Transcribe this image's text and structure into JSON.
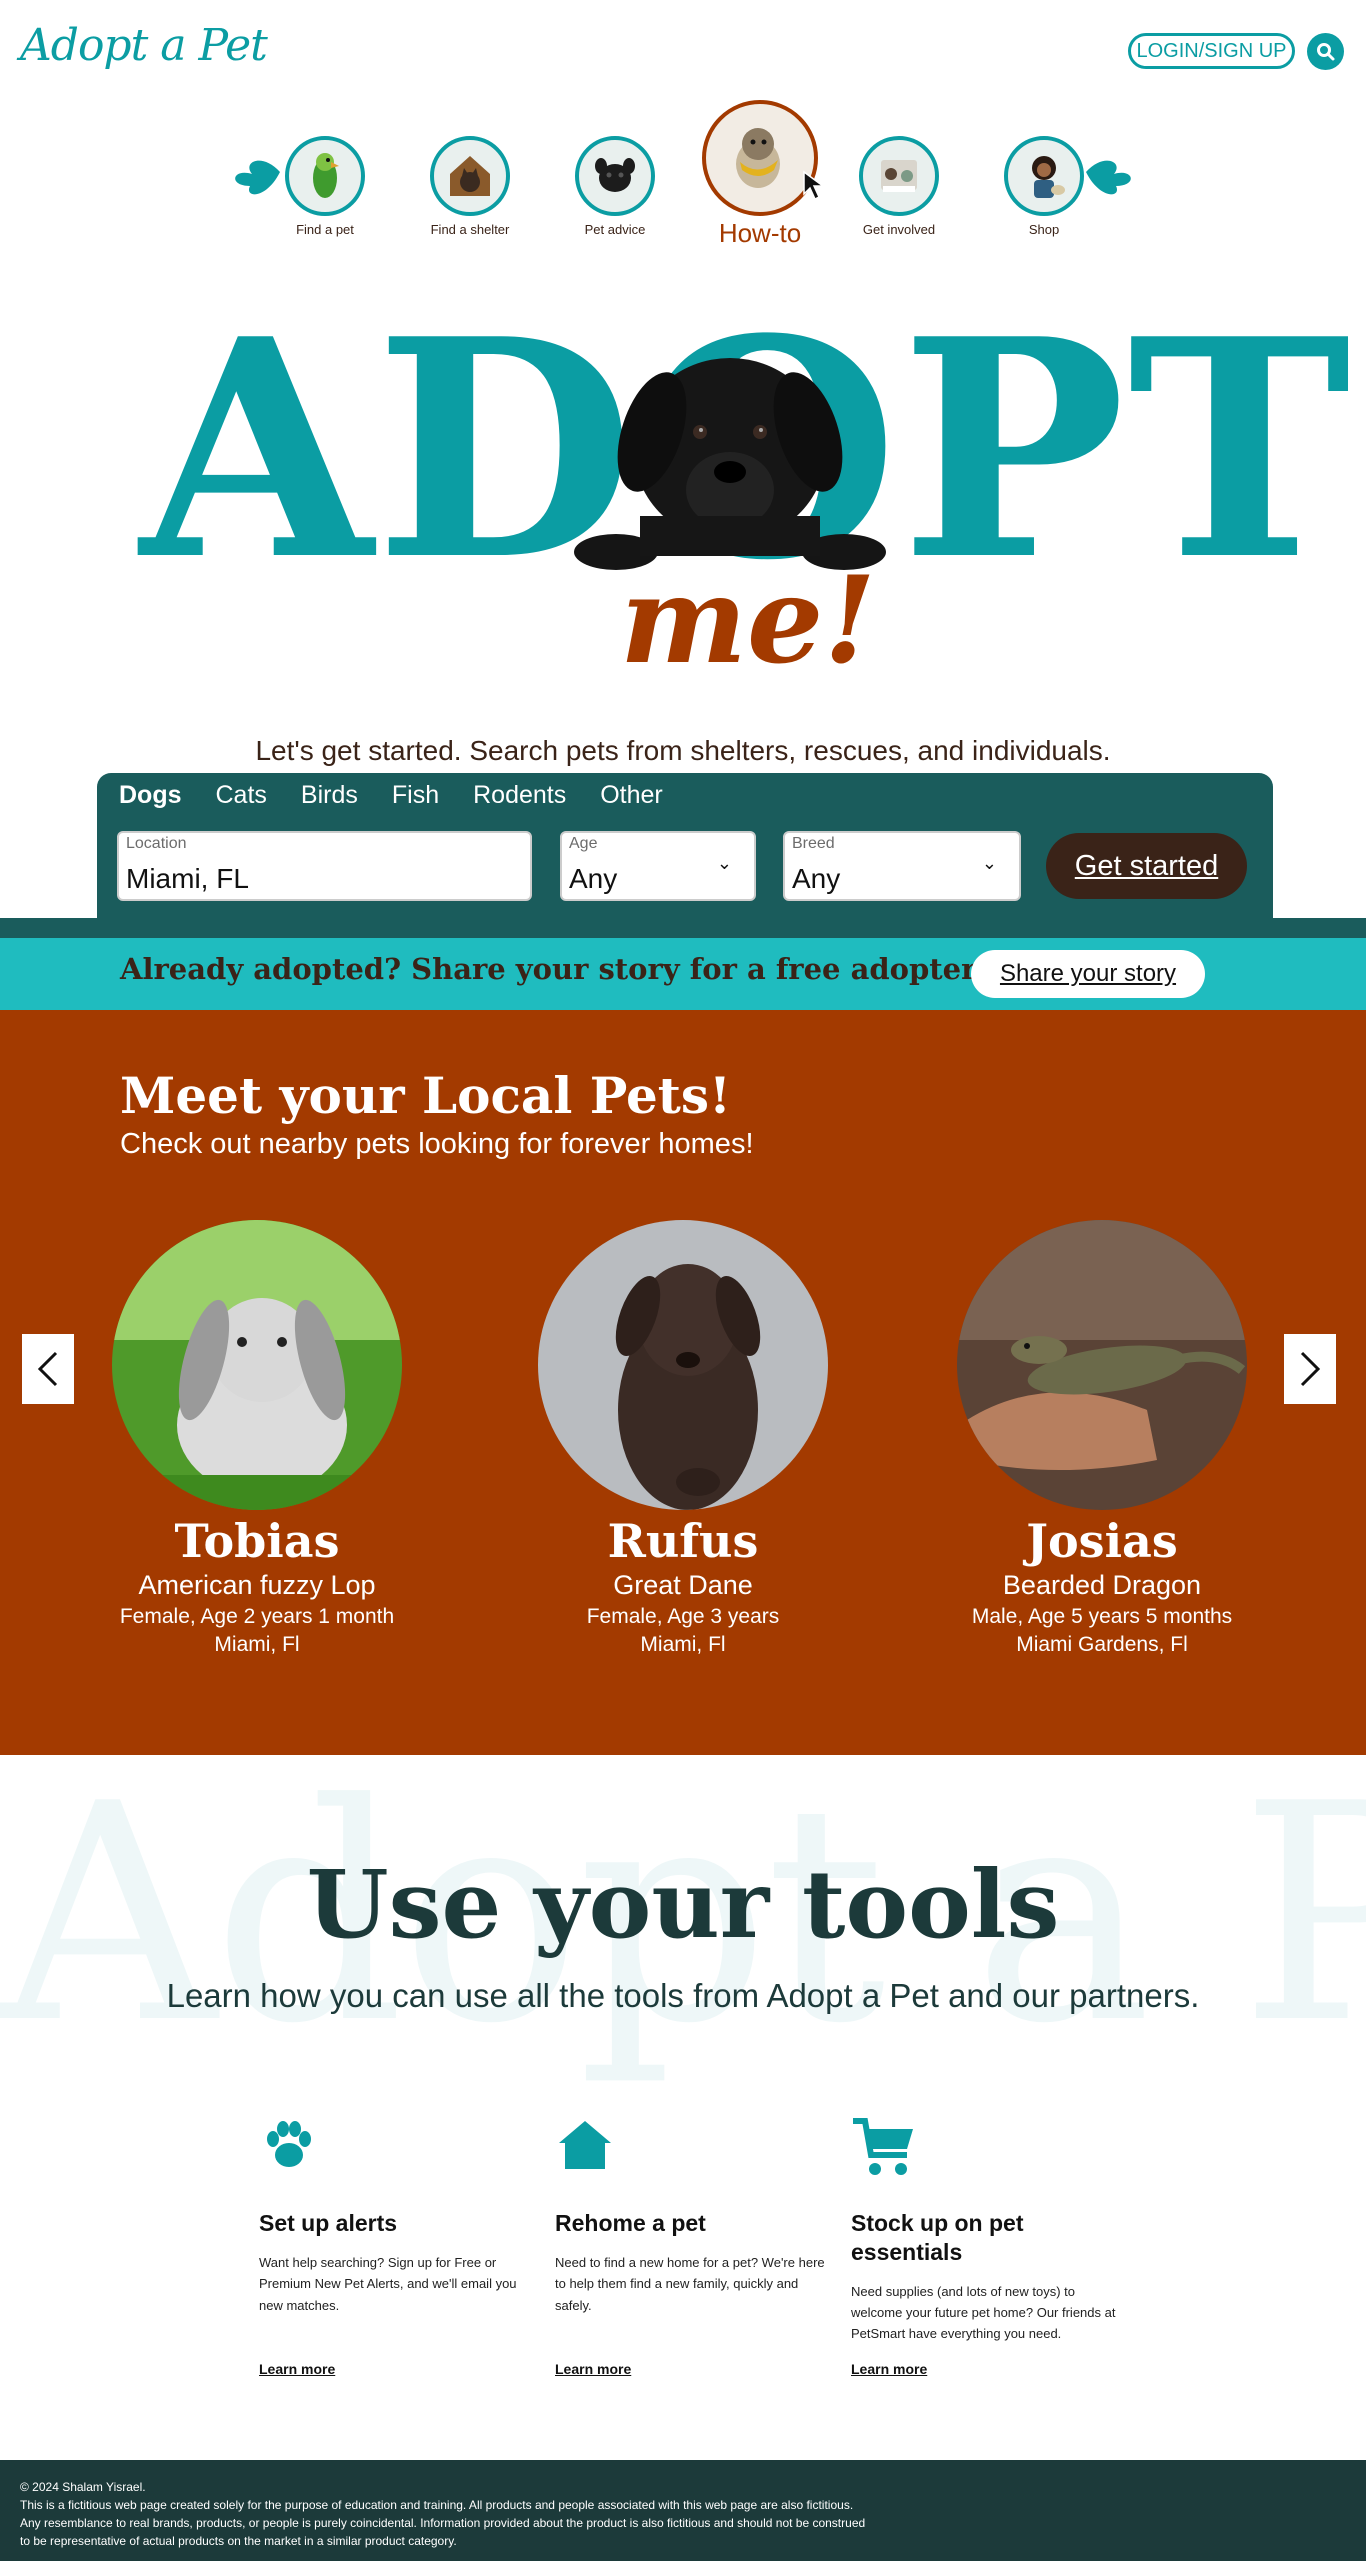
{
  "header": {
    "logo": "Adopt a Pet",
    "login_label": "LOGIN/SIGN UP",
    "search_icon": "search-icon"
  },
  "nav": {
    "items": [
      {
        "label": "Find a pet",
        "icon": "parrot"
      },
      {
        "label": "Find a shelter",
        "icon": "cat"
      },
      {
        "label": "Pet advice",
        "icon": "pug"
      },
      {
        "label": "How-to",
        "icon": "dog-with-scarf",
        "active": true
      },
      {
        "label": "Get involved",
        "icon": "volunteer"
      },
      {
        "label": "Shop",
        "icon": "shopper-with-dog"
      }
    ]
  },
  "hero": {
    "word": "ADOPT",
    "tagline": "me!"
  },
  "search": {
    "intro": "Let's get started. Search pets from shelters, rescues, and individuals.",
    "tabs": [
      "Dogs",
      "Cats",
      "Birds",
      "Fish",
      "Rodents",
      "Other"
    ],
    "active_tab": "Dogs",
    "location": {
      "label": "Location",
      "value": "Miami, FL"
    },
    "age": {
      "label": "Age",
      "value": "Any"
    },
    "breed": {
      "label": "Breed",
      "value": "Any"
    },
    "submit_label": "Get started"
  },
  "share": {
    "text": "Already adopted? Share your story for a free adopter kit.",
    "button_label": "Share your story"
  },
  "local_pets": {
    "title": "Meet your Local Pets!",
    "subtitle": "Check out nearby pets looking for forever homes!",
    "pets": [
      {
        "name": "Tobias",
        "breed": "American fuzzy Lop",
        "details": "Female, Age 2 years 1 month",
        "location": "Miami, Fl"
      },
      {
        "name": "Rufus",
        "breed": "Great Dane",
        "details": "Female, Age 3 years",
        "location": "Miami, Fl"
      },
      {
        "name": "Josias",
        "breed": "Bearded Dragon",
        "details": "Male, Age 5 years 5 months",
        "location": "Miami Gardens, Fl"
      }
    ]
  },
  "tools": {
    "watermark": "Adopt a Pet",
    "title": "Use your tools",
    "subtitle": "Learn how you can use all the tools from Adopt a Pet and our partners.",
    "items": [
      {
        "icon": "paw-icon",
        "title": "Set up alerts",
        "description": "Want help searching? Sign up for Free or Premium New Pet Alerts, and we'll email you new matches.",
        "link": "Learn more"
      },
      {
        "icon": "house-icon",
        "title": "Rehome a pet",
        "description": "Need to find a new home for a pet? We're here to help them find a new family, quickly and safely.",
        "link": "Learn more"
      },
      {
        "icon": "cart-icon",
        "title": "Stock up on pet essentials",
        "description": "Need supplies (and lots of new toys) to welcome your future pet home? Our friends at PetSmart have everything you need.",
        "link": "Learn more"
      }
    ]
  },
  "footer": {
    "copyright": "© 2024 Shalam Yisrael.",
    "line1": "This is a fictitious web page created solely for the purpose of education and training. All products and people associated with this web page are also fictitious.",
    "line2": "Any resemblance to real brands, products, or people is purely coincidental. Information provided about the product is also fictitious and should not be construed",
    "line3": "to be representative of actual products on the market in a similar product category."
  },
  "colors": {
    "teal": "#0b9da3",
    "dark_teal": "#1a5c5c",
    "rust": "#a33a00",
    "brown": "#3a2318",
    "banner_teal": "#1fbcbf",
    "footer": "#1c3a3a"
  }
}
